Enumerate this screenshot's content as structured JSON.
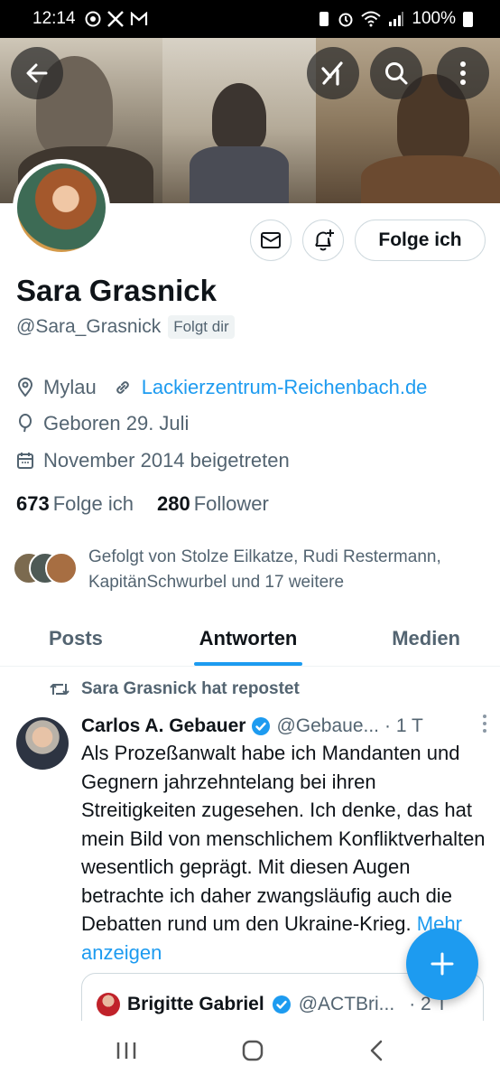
{
  "status_bar": {
    "time": "12:14",
    "battery": "100%"
  },
  "profile": {
    "name": "Sara Grasnick",
    "handle": "@Sara_Grasnick",
    "follows_you": "Folgt dir",
    "follow_button": "Folge ich",
    "location": "Mylau",
    "website": "Lackierzentrum-Reichenbach.de",
    "birthday": "Geboren 29. Juli",
    "joined": "November 2014 beigetreten",
    "following_count": "673",
    "following_label": "Folge ich",
    "followers_count": "280",
    "followers_label": "Follower",
    "followed_by": "Gefolgt von Stolze Eilkatze, Rudi Restermann, KapitänSchwurbel und 17 weitere"
  },
  "tabs": [
    {
      "label": "Posts",
      "active": false
    },
    {
      "label": "Antworten",
      "active": true
    },
    {
      "label": "Medien",
      "active": false
    }
  ],
  "feed": {
    "repost_label": "Sara Grasnick hat repostet",
    "tweet": {
      "author": "Carlos A. Gebauer",
      "handle": "@Gebaue...",
      "time": "· 1 T",
      "text": "Als Prozeßanwalt habe ich Mandanten und Gegnern jahrzehntelang bei ihren Streitigkeiten zugesehen. Ich denke, das hat mein Bild von menschlichem Konfliktverhalten wesentlich geprägt. Mit diesen Augen betrachte ich daher zwangsläufig auch die Debatten rund um den Ukraine-Krieg.",
      "show_more": "Mehr anzeigen",
      "quote": {
        "author": "Brigitte Gabriel",
        "handle": "@ACTBri...",
        "time": "· 2 T"
      }
    }
  },
  "colors": {
    "accent": "#1d9bf0",
    "text": "#0f1419",
    "secondary": "#536471"
  }
}
